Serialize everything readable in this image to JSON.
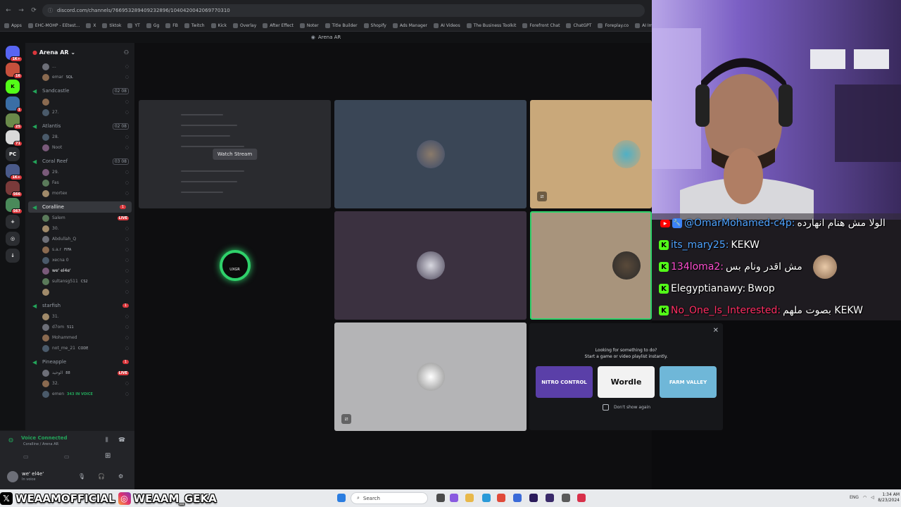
{
  "browser": {
    "url": "discord.com/channels/766953289409232896/1040420042069770310",
    "tab_strip_title": "Arena AR",
    "bookmarks": [
      "Apps",
      "EHC-MOHP - EEtest...",
      "X",
      "tiktok",
      "YT",
      "Gg",
      "FB",
      "Twitch",
      "Kick",
      "Overlay",
      "After Effect",
      "Noter",
      "Title Builder",
      "Shopify",
      "Ads Manager",
      "AI Videos",
      "The Business Toolkit",
      "Forefront Chat",
      "ChatGPT",
      "Foreplay.co",
      "AI Image"
    ]
  },
  "rail": {
    "items": [
      {
        "label": "",
        "badge": "1K+",
        "color": "#5865f2"
      },
      {
        "label": "",
        "badge": "16",
        "color": "#c7503c"
      },
      {
        "label": "K",
        "badge": "",
        "color": "#53fc18"
      },
      {
        "label": "",
        "badge": "1",
        "color": "#3a6ea5"
      },
      {
        "label": "",
        "badge": "25",
        "color": "#6a8a4a"
      },
      {
        "label": "",
        "badge": "71",
        "color": "#d9d9d9"
      },
      {
        "label": "PC",
        "badge": "",
        "color": "#2b2d31"
      },
      {
        "label": "",
        "badge": "1K+",
        "color": "#4a5a8a"
      },
      {
        "label": "",
        "badge": "566",
        "color": "#7a3a3a"
      },
      {
        "label": "",
        "badge": "567",
        "color": "#4a8a5a"
      },
      {
        "label": "+",
        "badge": "",
        "color": "#2b2d31"
      },
      {
        "label": "◎",
        "badge": "",
        "color": "#2b2d31"
      },
      {
        "label": "↓",
        "badge": "",
        "color": "#2b2d31"
      }
    ]
  },
  "server": {
    "name": "Arena AR"
  },
  "channels": [
    {
      "name": "",
      "users": [
        {
          "name": "...",
          "tag": ""
        },
        {
          "name": "emar",
          "tag": "SQL"
        }
      ]
    },
    {
      "name": "Sandcastle",
      "count": "02 08",
      "users": [
        {
          "name": "",
          "tag": ""
        },
        {
          "name": "27.",
          "tag": ""
        }
      ]
    },
    {
      "name": "Atlantis",
      "count": "02 08",
      "users": [
        {
          "name": "28.",
          "tag": ""
        },
        {
          "name": "Noot",
          "tag": ""
        }
      ]
    },
    {
      "name": "Coral Reef",
      "count": "03 08",
      "users": [
        {
          "name": "29.",
          "tag": ""
        },
        {
          "name": "Fas",
          "tag": ""
        },
        {
          "name": "mortex",
          "tag": ""
        }
      ]
    },
    {
      "name": "Coralline",
      "pill": "1",
      "users": [
        {
          "name": "Salem",
          "tag": "",
          "live": "LIVE"
        },
        {
          "name": "30.",
          "tag": ""
        },
        {
          "name": "Abdullah_Q",
          "tag": ""
        },
        {
          "name": "s.a.r",
          "tag": "FIFA"
        },
        {
          "name": "xecna 0",
          "tag": ""
        },
        {
          "name": "we' el4e'",
          "tag": ""
        },
        {
          "name": "sultansg511",
          "tag": "CS2"
        },
        {
          "name": "",
          "tag": ""
        }
      ]
    },
    {
      "name": "starfish",
      "pill": "1",
      "users": [
        {
          "name": "31.",
          "tag": ""
        },
        {
          "name": "d7om",
          "tag": "511"
        },
        {
          "name": "Mohammed",
          "tag": ""
        },
        {
          "name": "not_me_21",
          "tag": "CODE"
        }
      ]
    },
    {
      "name": "Pineapple",
      "pill": "1",
      "users": [
        {
          "name": "الوحيد",
          "tag": "88",
          "live": "LIVE"
        },
        {
          "name": "32.",
          "tag": ""
        },
        {
          "name": "emen",
          "tag": "343 IN VOICE"
        }
      ]
    }
  ],
  "voice": {
    "status": "Voice Connected",
    "location": "Coralline / Arena AR"
  },
  "user": {
    "name": "we' el4e'",
    "status": "In voice"
  },
  "stage": {
    "watch_label": "Watch Stream",
    "tiles": [
      {
        "name": "stream-tile",
        "bg": "#2a2b2f"
      },
      {
        "name": "slate-tile",
        "bg": "#3a4656"
      },
      {
        "name": "sand-tile",
        "bg": "#c9a87a"
      },
      {
        "name": "logo-tile",
        "bg": "#0e0e10",
        "logo_text": "UXGR"
      },
      {
        "name": "plum-tile",
        "bg": "#3b3140"
      },
      {
        "name": "beige-tile",
        "bg": "#a8947c"
      },
      {
        "name": "silver-tile",
        "bg": "#b4b4b6"
      }
    ]
  },
  "activity": {
    "line1": "Looking for something to do?",
    "line2": "Start a game or video playlist instantly.",
    "games": [
      {
        "label": "NITRO CONTROL",
        "bg": "#5a3fa8",
        "fg": "#ffffff"
      },
      {
        "label": "Wordle",
        "bg": "#f2f2f2",
        "fg": "#111111"
      },
      {
        "label": "FARM VALLEY",
        "bg": "#6fb7d8",
        "fg": "#ffffff"
      }
    ],
    "checkbox_label": "Don't show again"
  },
  "chat": {
    "messages": [
      {
        "platform": "youtube",
        "user": "@OmarMohamed-c4p:",
        "text": "الولا مش هنام انهارده",
        "color": "#ffffff"
      },
      {
        "platform": "kick",
        "user": "its_mary25:",
        "text": "KEKW",
        "color": "#4fa3ff"
      },
      {
        "platform": "kick",
        "user": "134loma2:",
        "text": "مش اقدر ونام بس",
        "color": "#ff4fd1"
      },
      {
        "platform": "kick",
        "user": "Elegyptianawy:",
        "text": "Bwop",
        "color": "#ffffff"
      },
      {
        "platform": "kick",
        "user": "No_One_Is_Interested:",
        "text": "بصوت ملهم KEKW",
        "color": "#ff2e63"
      }
    ]
  },
  "overlay": {
    "twitter": "WEAAMOFFICIAL",
    "instagram": "WEAAM_GEKA"
  },
  "taskbar": {
    "search_placeholder": "Search",
    "lang": "ENG",
    "time": "1:34 AM",
    "date": "8/23/2024"
  }
}
